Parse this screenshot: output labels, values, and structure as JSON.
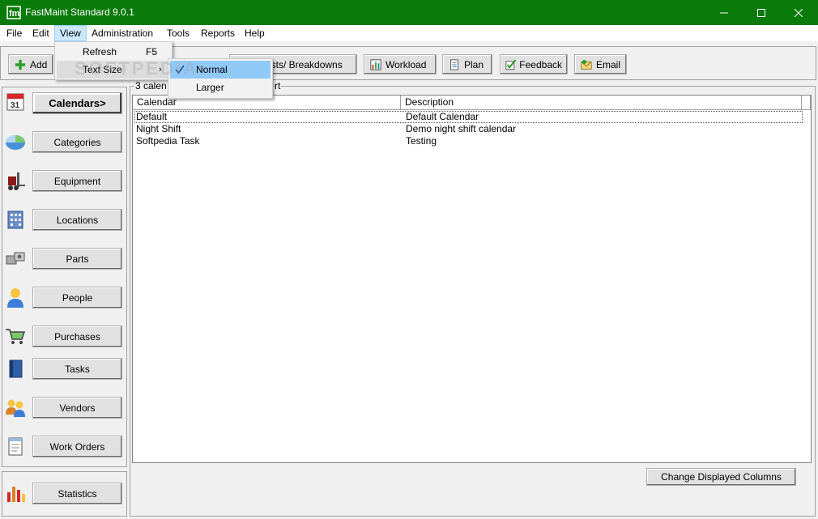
{
  "window": {
    "title": "FastMaint Standard 9.0.1"
  },
  "menubar": [
    "File",
    "Edit",
    "View",
    "Administration",
    "Tools",
    "Reports",
    "Help"
  ],
  "toolbar": {
    "add": "Add",
    "breakdowns": "asts/ Breakdowns",
    "workload": "Workload",
    "plan": "Plan",
    "feedback": "Feedback",
    "email": "Email"
  },
  "view_menu": {
    "refresh": "Refresh",
    "refresh_shortcut": "F5",
    "text_size": "Text Size"
  },
  "text_size_menu": {
    "normal": "Normal",
    "larger": "Larger"
  },
  "watermark": "SOFTPEDIA",
  "sidebar": {
    "calendars": "Calendars>",
    "categories": "Categories",
    "equipment": "Equipment",
    "locations": "Locations",
    "parts": "Parts",
    "people": "People",
    "purchases": "Purchases",
    "tasks": "Tasks",
    "vendors": "Vendors",
    "work_orders": "Work Orders",
    "statistics": "Statistics"
  },
  "main": {
    "group_caption_left": "3 calen",
    "group_caption_right": "rt",
    "columns": [
      "Calendar",
      "Description"
    ],
    "rows": [
      {
        "calendar": "Default",
        "description": "Default Calendar"
      },
      {
        "calendar": "Night Shift",
        "description": "Demo night shift calendar"
      },
      {
        "calendar": "Softpedia Task",
        "description": "Testing"
      }
    ],
    "change_columns": "Change Displayed Columns"
  }
}
